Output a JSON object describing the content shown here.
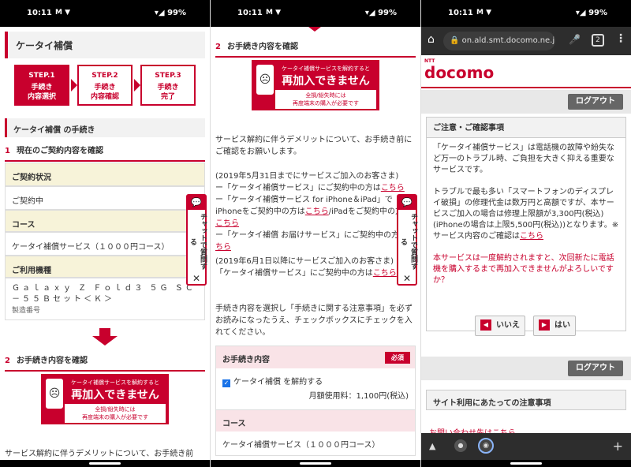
{
  "status": {
    "time": "10:11",
    "battery": "99%",
    "icons": "M ▼",
    "signal": "▾◢"
  },
  "p1": {
    "title": "ケータイ補償",
    "steps": [
      {
        "num": "STEP.1",
        "label": "手続き\n内容選択"
      },
      {
        "num": "STEP.2",
        "label": "手続き\n内容確認"
      },
      {
        "num": "STEP.3",
        "label": "手続き\n完了"
      }
    ],
    "subhead": "ケータイ補償 の手続き",
    "section1": {
      "num": "1",
      "title": "現在のご契約内容を確認"
    },
    "rows": {
      "contract_head": "ご契約状況",
      "contract_val": "ご契約中",
      "course_head": "コース",
      "course_val": "ケータイ補償サービス（１０００円コース）",
      "device_head": "ご利用機種",
      "device_val": "Ｇａｌａｘｙ Ｚ Ｆｏｌｄ３ ５Ｇ ＳＣ－５５Ｂセット＜Ｋ＞",
      "serial": "製造番号"
    },
    "section2": {
      "num": "2",
      "title": "お手続き内容を確認"
    },
    "bottom_text": "サービス解約に伴うデメリットについて、お手続き前"
  },
  "banner": {
    "line1": "ケータイ補償サービスを解約すると",
    "line2": "再加入できません",
    "line3": "全損/紛失時には",
    "line4": "再度端末の購入が必要です"
  },
  "sidetab": {
    "label": "チャットで質問する",
    "close": "✕",
    "icon": "💬"
  },
  "p2": {
    "section2": {
      "num": "2",
      "title": "お手続き内容を確認"
    },
    "para1": "サービス解約に伴うデメリットについて、お手続き前にご確認をお願いします。",
    "para2_a": "(2019年5月31日までにサービスご加入のお客さま)",
    "para2_b": "ー「ケータイ補償サービス」にご契約中の方は",
    "para2_c": "ー「ケータイ補償サービス for iPhone＆iPad」でiPhoneをご契約中の方は",
    "para2_c2": "/iPadをご契約中の方は",
    "para2_d": "ー「ケータイ補償 お届けサービス」にご契約中の方は",
    "link": "こちら",
    "para3_a": "(2019年6月1日以降にサービスご加入のお客さま)",
    "para3_b": "「ケータイ補償サービス」にご契約中の方は",
    "para4": "手続き内容を選択し「手続きに関する注意事項」を必ずお読みになったうえ、チェックボックスにチェックを入れてください。",
    "proc_head": "お手続き内容",
    "required": "必須",
    "checkbox_label": "ケータイ補償 を解約する",
    "fee": "月額使用料：1,100円(税込)",
    "course_head": "コース",
    "course_val": "ケータイ補償サービス（１０００円コース）"
  },
  "p3": {
    "url": "on.ald.smt.docomo.ne.jp",
    "tab_count": "2",
    "ntt": "NTT",
    "logo": "docomo",
    "logout": "ログアウト",
    "notice_head": "ご注意・ご確認事項",
    "notice_p1": "「ケータイ補償サービス」は電話機の故障や紛失など万一のトラブル時、ご負担を大きく抑える重要なサービスです。",
    "notice_p2": "トラブルで最も多い「スマートフォンのディスプレイ破損」の修理代金は数万円と高額ですが、本サービスご加入の場合は修理上限額が3,300円(税込)(iPhoneの場合は上限5,500円(税込))となります。※サービス内容のご確認は",
    "notice_link": "こちら",
    "notice_warn": "本サービスは一度解約されますと、次回新たに電話機を購入するまで再加入できませんがよろしいですか？",
    "no": "いいえ",
    "yes": "はい",
    "site_head": "サイト利用にあたっての注意事項",
    "footer_link": "お問い合わせ先はこちら"
  }
}
